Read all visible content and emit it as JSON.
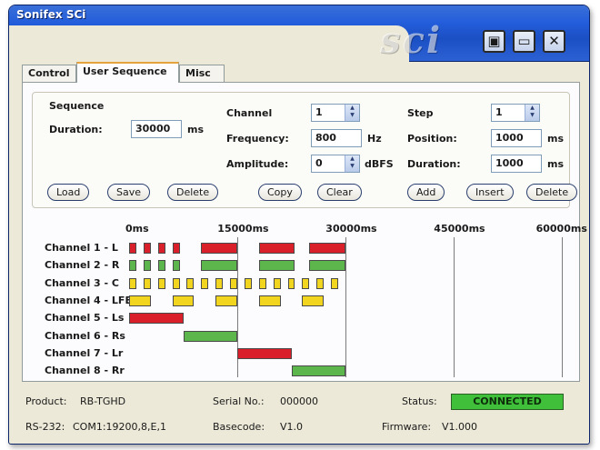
{
  "window": {
    "title": "Sonifex SCi",
    "logo": "sci"
  },
  "titlebar_buttons": [
    {
      "name": "restore",
      "symbol": "▣"
    },
    {
      "name": "minimize",
      "symbol": "▭"
    },
    {
      "name": "close",
      "symbol": "✕"
    }
  ],
  "tabs": [
    {
      "label": "Control",
      "active": false
    },
    {
      "label": "User Sequence",
      "active": true
    },
    {
      "label": "Misc",
      "active": false
    }
  ],
  "sequence": {
    "heading": "Sequence",
    "duration_label": "Duration:",
    "duration_value": "30000",
    "duration_unit": "ms",
    "buttons": {
      "load": "Load",
      "save": "Save",
      "delete": "Delete"
    }
  },
  "channel": {
    "channel_label": "Channel",
    "channel_value": "1",
    "frequency_label": "Frequency:",
    "frequency_value": "800",
    "frequency_unit": "Hz",
    "amplitude_label": "Amplitude:",
    "amplitude_value": "0",
    "amplitude_unit": "dBFS",
    "buttons": {
      "copy": "Copy",
      "clear": "Clear"
    }
  },
  "step": {
    "step_label": "Step",
    "step_value": "1",
    "position_label": "Position:",
    "position_value": "1000",
    "position_unit": "ms",
    "duration_label": "Duration:",
    "duration_value": "1000",
    "duration_unit": "ms",
    "buttons": {
      "add": "Add",
      "insert": "Insert",
      "delete": "Delete"
    }
  },
  "timeline": {
    "ticks": [
      "0ms",
      "15000ms",
      "30000ms",
      "45000ms",
      "60000ms"
    ],
    "range_ms": [
      0,
      60000
    ],
    "colors": {
      "red": "#d9202a",
      "green": "#5db64b",
      "yellow": "#f1d51f"
    },
    "channels": [
      {
        "label": "Channel 1 - L",
        "color": "red",
        "steps": [
          [
            0,
            1000
          ],
          [
            2000,
            1000
          ],
          [
            4000,
            1000
          ],
          [
            6000,
            1000
          ],
          [
            10000,
            5000
          ],
          [
            18000,
            5000
          ],
          [
            25000,
            5000
          ]
        ]
      },
      {
        "label": "Channel 2 - R",
        "color": "green",
        "steps": [
          [
            0,
            1000
          ],
          [
            2000,
            1000
          ],
          [
            4000,
            1000
          ],
          [
            6000,
            1000
          ],
          [
            10000,
            5000
          ],
          [
            18000,
            5000
          ],
          [
            25000,
            5000
          ]
        ]
      },
      {
        "label": "Channel 3 - C",
        "color": "yellow",
        "steps": [
          [
            0,
            1000
          ],
          [
            2000,
            1000
          ],
          [
            4000,
            1000
          ],
          [
            6000,
            1000
          ],
          [
            8000,
            1000
          ],
          [
            10000,
            1000
          ],
          [
            12000,
            1000
          ],
          [
            14000,
            1000
          ],
          [
            16000,
            1000
          ],
          [
            18000,
            1000
          ],
          [
            20000,
            1000
          ],
          [
            22000,
            1000
          ],
          [
            24000,
            1000
          ],
          [
            26000,
            1000
          ],
          [
            28000,
            1000
          ]
        ]
      },
      {
        "label": "Channel 4 - LFE",
        "color": "yellow",
        "steps": [
          [
            0,
            3000
          ],
          [
            6000,
            3000
          ],
          [
            12000,
            3000
          ],
          [
            18000,
            3000
          ],
          [
            24000,
            3000
          ]
        ]
      },
      {
        "label": "Channel 5 - Ls",
        "color": "red",
        "steps": [
          [
            0,
            7500
          ]
        ]
      },
      {
        "label": "Channel 6 - Rs",
        "color": "green",
        "steps": [
          [
            7500,
            7500
          ]
        ]
      },
      {
        "label": "Channel 7 - Lr",
        "color": "red",
        "steps": [
          [
            15000,
            7500
          ]
        ]
      },
      {
        "label": "Channel 8 - Rr",
        "color": "green",
        "steps": [
          [
            22500,
            7500
          ]
        ]
      }
    ]
  },
  "status": {
    "product_label": "Product:",
    "product_value": "RB-TGHD",
    "serial_label": "Serial No.:",
    "serial_value": "000000",
    "status_label": "Status:",
    "status_value": "CONNECTED",
    "rs232_label": "RS-232:",
    "rs232_value": "COM1:19200,8,E,1",
    "basecode_label": "Basecode:",
    "basecode_value": "V1.0",
    "firmware_label": "Firmware:",
    "firmware_value": "V1.000"
  }
}
